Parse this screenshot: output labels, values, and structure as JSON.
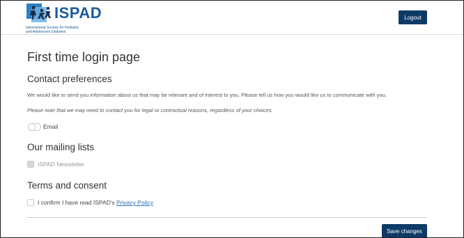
{
  "header": {
    "logo_text": "ISPAD",
    "logo_subtitle_line1": "International Society for Pediatric",
    "logo_subtitle_line2": "and Adolescent Diabetes",
    "logout_label": "Logout"
  },
  "page": {
    "title": "First time login page"
  },
  "contact": {
    "heading": "Contact preferences",
    "intro": "We would like to send you information about us that may be relevant and of interest to you. Please tell us how you would like us to communicate with you.",
    "note": "Please note that we may need to contact you for legal or contractual reasons, regardless of your choices.",
    "email_label": "Email",
    "email_enabled": false
  },
  "mailing": {
    "heading": "Our mailing lists",
    "newsletter_label": "ISPAD Newsletter",
    "newsletter_checked": false
  },
  "terms": {
    "heading": "Terms and consent",
    "confirm_prefix": "I confirm I have read ISPAD's ",
    "privacy_link": "Privacy Policy",
    "checked": false
  },
  "actions": {
    "save_label": "Save changes"
  },
  "colors": {
    "brand": "#1d5a9b",
    "button_bg": "#0d3b66",
    "link": "#2a6fb3"
  }
}
